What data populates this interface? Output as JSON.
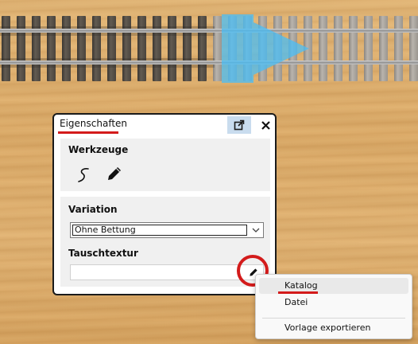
{
  "panel": {
    "title": "Eigenschaften",
    "popout_icon": "popout-icon",
    "close_icon": "close-icon",
    "tools": {
      "label": "Werkzeuge",
      "icons": [
        "freehand-curve-icon",
        "pencil-icon"
      ]
    },
    "variation": {
      "label": "Variation",
      "selected": "Ohne Bettung",
      "chevron_icon": "chevron-down-icon"
    },
    "swap_texture": {
      "label": "Tauschtextur",
      "value": "",
      "edit_icon": "pencil-icon"
    }
  },
  "context_menu": {
    "items": [
      "Katalog",
      "Datei",
      "Vorlage exportieren"
    ],
    "highlighted": "Katalog"
  },
  "colors": {
    "accent_red": "#d31b1b",
    "arrow_blue": "#49bef5",
    "popout_bg": "#c9dcee"
  }
}
